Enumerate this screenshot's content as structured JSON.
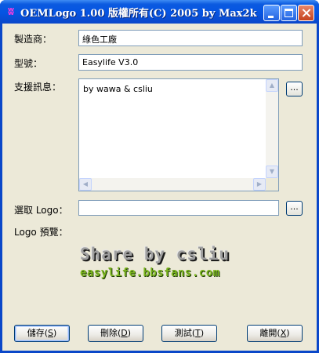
{
  "window": {
    "title": "OEMLogo 1.00 版權所有(C) 2005 by Max2k",
    "icon": "app-logo-icon",
    "accent": "#0a47c9"
  },
  "form": {
    "manufacturer_label": "製造商：",
    "manufacturer_value": "綠色工廠",
    "model_label": "型號：",
    "model_value": "Easylife V3.0",
    "support_label": "支援訊息：",
    "support_value": "by wawa & csliu",
    "browse_label": "...",
    "logo_select_label": "選取 Logo：",
    "logo_select_value": "",
    "logo_preview_label": "Logo 預覽："
  },
  "logo_preview": {
    "line1": "Share by csliu",
    "line2": "easylife.bbsfans.com"
  },
  "buttons": {
    "save": "儲存",
    "save_key": "S",
    "delete": "刪除",
    "delete_key": "D",
    "test": "測試",
    "test_key": "T",
    "exit": "離開",
    "exit_key": "X"
  }
}
